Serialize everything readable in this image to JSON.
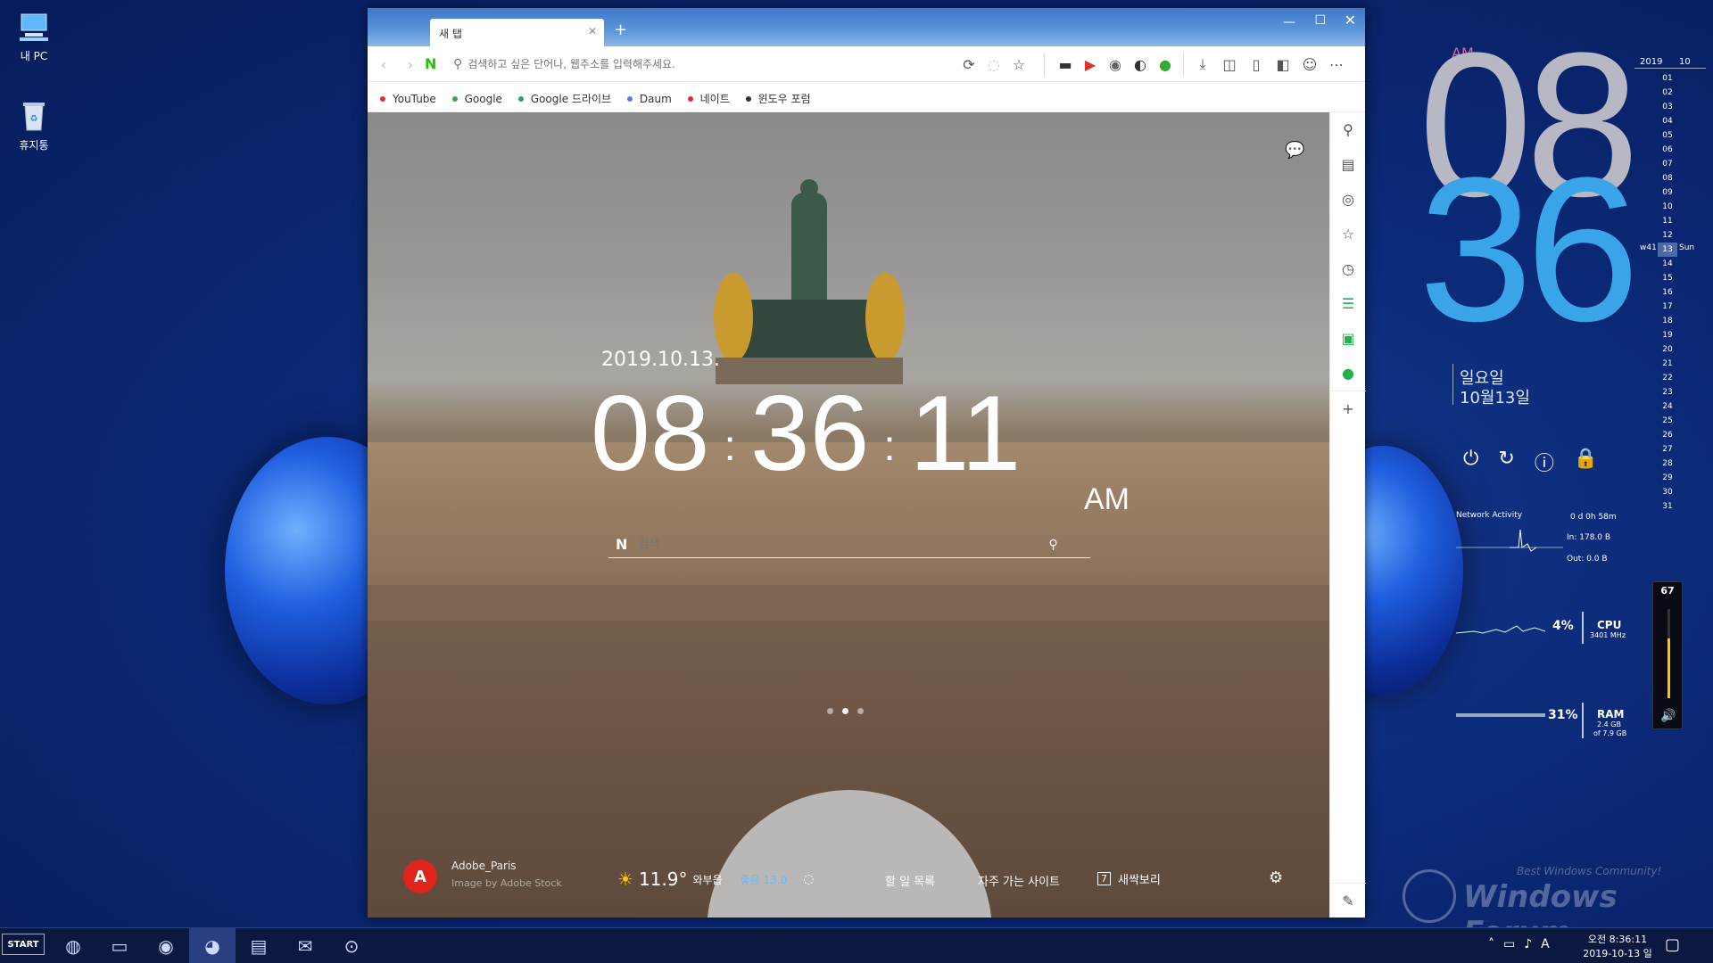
{
  "desktop": {
    "icons": [
      {
        "label": "내 PC",
        "icon": "computer-icon"
      },
      {
        "label": "휴지통",
        "icon": "recycle-bin-icon"
      }
    ]
  },
  "browser": {
    "tab_title": "새 탭",
    "address_placeholder": "검색하고 싶은 단어나, 웹주소를 입력해주세요.",
    "bookmarks": [
      {
        "label": "YouTube",
        "color": "#e52d27"
      },
      {
        "label": "Google",
        "color": "#34a853"
      },
      {
        "label": "Google 드라이브",
        "color": "#1fa463"
      },
      {
        "label": "Daum",
        "color": "#5b7be0"
      },
      {
        "label": "네이트",
        "color": "#e8262b"
      },
      {
        "label": "윈도우 포럼",
        "color": "#333333"
      }
    ],
    "newtab": {
      "date": "2019.10.13.",
      "hour": "08",
      "minute": "36",
      "second": "11",
      "ampm": "AM",
      "search_placeholder": "검색",
      "credit_name": "Adobe_Paris",
      "credit_sub": "Image by Adobe Stock",
      "weather_temp": "11.9°",
      "weather_desc": "와부읍",
      "air_quality": "좋음 13.0",
      "todo": "할 일 목록",
      "frequent": "자주 가는 사이트",
      "counter": "7",
      "dawn": "새싹보리"
    }
  },
  "clock_widget": {
    "ampm": "AM",
    "hour": "08",
    "minute": "36",
    "day": "일요일",
    "date": "10월13일"
  },
  "calendar": {
    "year": "2019",
    "month": "10",
    "week": "w41",
    "today": "13",
    "today_name": "Sun",
    "days": [
      "01",
      "02",
      "03",
      "04",
      "05",
      "06",
      "07",
      "08",
      "09",
      "10",
      "11",
      "12",
      "13",
      "14",
      "15",
      "16",
      "17",
      "18",
      "19",
      "20",
      "21",
      "22",
      "23",
      "24",
      "25",
      "26",
      "27",
      "28",
      "29",
      "30",
      "31"
    ]
  },
  "system": {
    "network_label": "Network Activity",
    "uptime": "0 d 0h 58m",
    "net_in": "In: 178.0 B",
    "net_out": "Out: 0.0 B",
    "cpu_percent": "4%",
    "cpu_label": "CPU",
    "cpu_freq": "3401 MHz",
    "ram_percent": "31%",
    "ram_label": "RAM",
    "ram_used": "2.4 GB",
    "ram_total": "of 7.9 GB",
    "volume": "67",
    "volume_level": 0.67
  },
  "watermark": {
    "tagline": "Best Windows Community!",
    "brand": "Windows Forum"
  },
  "taskbar": {
    "start": "START",
    "time": "오전 8:36:11",
    "date": "2019-10-13 일",
    "ime": "A"
  }
}
